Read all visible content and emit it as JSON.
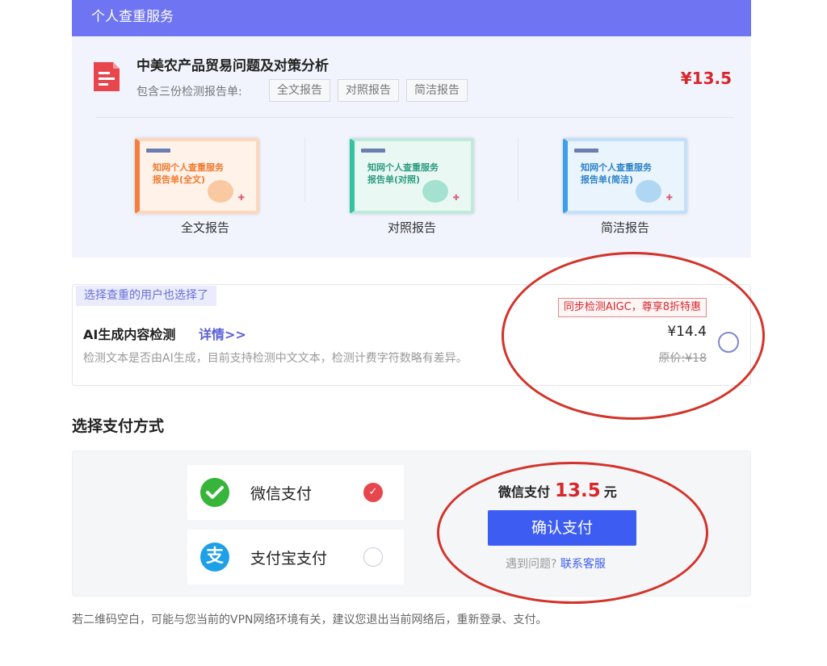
{
  "header": {
    "title": "个人查重服务"
  },
  "product": {
    "title": "中美农产品贸易问题及对策分析",
    "price": "¥13.5",
    "includes_label": "包含三份检测报告单:",
    "report_chips": [
      "全文报告",
      "对照报告",
      "简洁报告"
    ]
  },
  "report_cards": [
    {
      "line1": "知网个人查重服务",
      "line2": "报告单(全文)",
      "label": "全文报告",
      "accent": "#f47f3d"
    },
    {
      "line1": "知网个人查重服务",
      "line2": "报告单(对照)",
      "label": "对照报告",
      "accent": "#33c3a0"
    },
    {
      "line1": "知网个人查重服务",
      "line2": "报告单(简洁)",
      "label": "简洁报告",
      "accent": "#3f9ee8"
    }
  ],
  "aigc": {
    "tag": "选择查重的用户也选择了",
    "title": "AI生成内容检测",
    "detail_link": "详情>>",
    "description": "检测文本是否由AI生成，目前支持检测中文文本，检测计费字符数略有差异。",
    "discount_badge": "同步检测AIGC，尊享8折特惠",
    "price": "¥14.4",
    "original_price": "原价:¥18",
    "selected": false
  },
  "payment": {
    "heading": "选择支付方式",
    "options": [
      {
        "label": "微信支付",
        "icon": "wechat-pay-icon",
        "selected": true
      },
      {
        "label": "支付宝支付",
        "icon": "alipay-icon",
        "icon_glyph": "支",
        "selected": false
      }
    ],
    "confirm": {
      "method": "微信支付",
      "amount": "13.5",
      "unit": "元",
      "button_label": "确认支付",
      "help_text": "遇到问题?",
      "help_link": "联系客服"
    }
  },
  "footnote": "若二维码空白，可能与您当前的VPN网络环境有关，建议您退出当前网络后，重新登录、支付。",
  "colors": {
    "header_bg": "#6e74f2",
    "price_red": "#d8262b",
    "confirm_blue": "#3d5cf2",
    "annotation_red": "#d3332a"
  }
}
